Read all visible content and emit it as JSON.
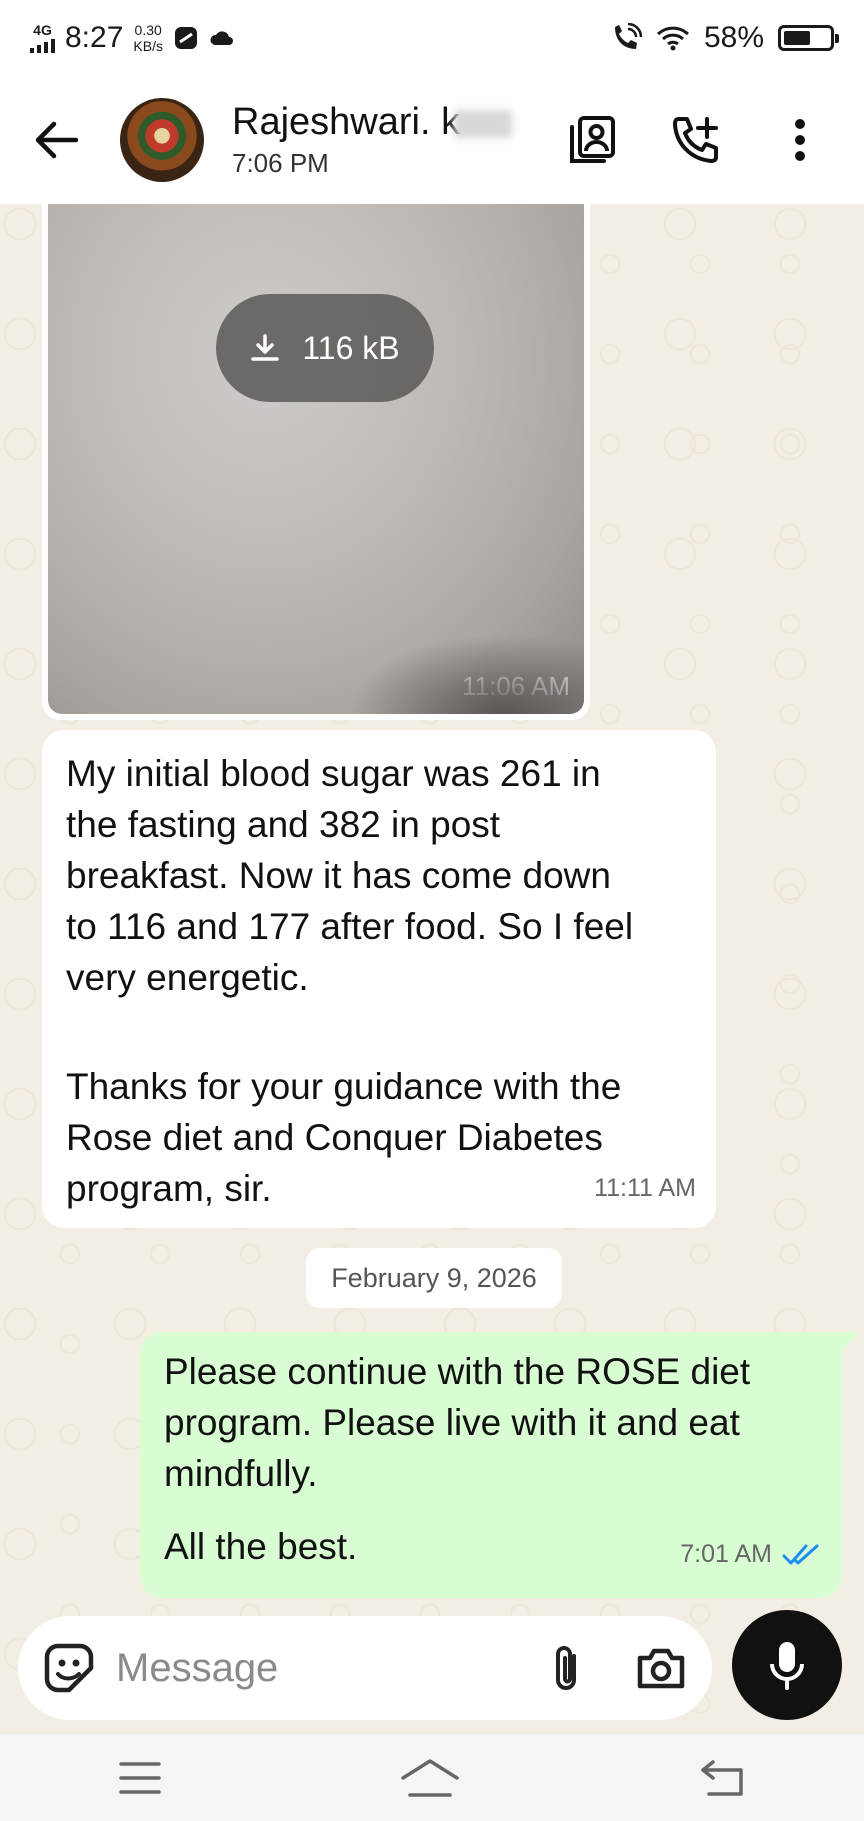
{
  "status_bar": {
    "network": "4G",
    "time": "8:27",
    "speed_value": "0.30",
    "speed_unit": "KB/s",
    "battery": "58%",
    "battery_level": 0.58
  },
  "header": {
    "contact_name": "Rajeshwari. k",
    "last_seen": "7:06 PM",
    "icons": [
      "back-arrow-icon",
      "avatar",
      "contact-card-icon",
      "add-call-icon",
      "more-vert-icon"
    ]
  },
  "messages": {
    "image": {
      "download_size": "116 kB",
      "time": "11:06 AM"
    },
    "incoming": {
      "paragraph_1": "My initial blood sugar was 261 in\nthe fasting and 382 in post\nbreakfast. Now it has come down\nto 116 and 177 after food. So I feel\nvery energetic.",
      "paragraph_2": "Thanks for your guidance with the\nRose diet and Conquer Diabetes\nprogram, sir.",
      "time": "11:11 AM"
    },
    "date_separator": "February 9, 2026",
    "outgoing": {
      "paragraph_1": "Please continue with the ROSE diet\nprogram. Please live with it and eat\nmindfully.",
      "paragraph_2": "All the best.",
      "time": "7:01 AM",
      "read_color": "#1b8ef2"
    }
  },
  "composer": {
    "placeholder": "Message"
  },
  "colors": {
    "outgoing_bubble": "#d9fdd3",
    "chat_background": "#f3eee3"
  }
}
